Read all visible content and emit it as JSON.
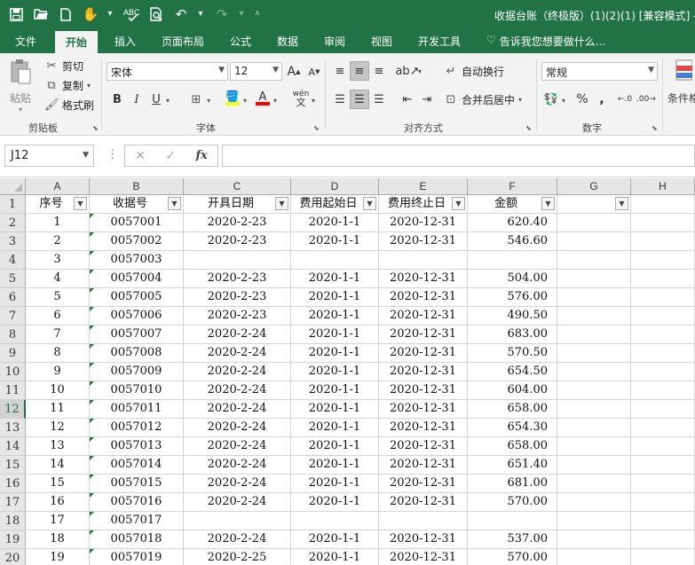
{
  "window": {
    "title": "收据台账（终极版）(1)(2)(1) [兼容模式] - E"
  },
  "quick_access": {
    "icons": [
      "save-icon",
      "open-icon",
      "new-icon",
      "touch-mode-icon",
      "spell-check-icon",
      "print-preview-icon",
      "undo-icon",
      "redo-icon",
      "customize-icon"
    ]
  },
  "tabs": [
    {
      "label": "文件",
      "active": false
    },
    {
      "label": "开始",
      "active": true
    },
    {
      "label": "插入",
      "active": false
    },
    {
      "label": "页面布局",
      "active": false
    },
    {
      "label": "公式",
      "active": false
    },
    {
      "label": "数据",
      "active": false
    },
    {
      "label": "审阅",
      "active": false
    },
    {
      "label": "视图",
      "active": false
    },
    {
      "label": "开发工具",
      "active": false
    }
  ],
  "tell_me": "告诉我您想要做什么...",
  "ribbon": {
    "clipboard": {
      "paste": "粘贴",
      "cut": "剪切",
      "copy": "复制",
      "format_painter": "格式刷",
      "label": "剪贴板"
    },
    "font": {
      "name": "宋体",
      "size": "12",
      "bold": "B",
      "italic": "I",
      "underline": "U",
      "grow": "A",
      "shrink": "A",
      "wen": "wén",
      "label": "字体"
    },
    "alignment": {
      "wrap_text": "自动换行",
      "merge_center": "合并后居中",
      "label": "对齐方式"
    },
    "number": {
      "format": "常规",
      "percent": "%",
      "comma": ",",
      "label": "数字"
    },
    "styles": {
      "conditional": "条件格"
    }
  },
  "formula_bar": {
    "name_box": "J12",
    "cancel": "✕",
    "enter": "✓",
    "fx": "fx",
    "value": ""
  },
  "sheet": {
    "columns": [
      "A",
      "B",
      "C",
      "D",
      "E",
      "F",
      "G",
      "H"
    ],
    "selected_row": "12",
    "headers": [
      "序号",
      "收据号",
      "开具日期",
      "费用起始日",
      "费用终止日",
      "金额",
      ""
    ],
    "rows": [
      {
        "num": "2",
        "cells": [
          "1",
          "0057001",
          "2020-2-23",
          "2020-1-1",
          "2020-12-31",
          "620.40"
        ]
      },
      {
        "num": "3",
        "cells": [
          "2",
          "0057002",
          "2020-2-23",
          "2020-1-1",
          "2020-12-31",
          "546.60"
        ]
      },
      {
        "num": "4",
        "cells": [
          "3",
          "0057003",
          "",
          "",
          "",
          ""
        ]
      },
      {
        "num": "5",
        "cells": [
          "4",
          "0057004",
          "2020-2-23",
          "2020-1-1",
          "2020-12-31",
          "504.00"
        ]
      },
      {
        "num": "6",
        "cells": [
          "5",
          "0057005",
          "2020-2-23",
          "2020-1-1",
          "2020-12-31",
          "576.00"
        ]
      },
      {
        "num": "7",
        "cells": [
          "6",
          "0057006",
          "2020-2-23",
          "2020-1-1",
          "2020-12-31",
          "490.50"
        ]
      },
      {
        "num": "8",
        "cells": [
          "7",
          "0057007",
          "2020-2-24",
          "2020-1-1",
          "2020-12-31",
          "683.00"
        ]
      },
      {
        "num": "9",
        "cells": [
          "8",
          "0057008",
          "2020-2-24",
          "2020-1-1",
          "2020-12-31",
          "570.50"
        ]
      },
      {
        "num": "10",
        "cells": [
          "9",
          "0057009",
          "2020-2-24",
          "2020-1-1",
          "2020-12-31",
          "654.50"
        ]
      },
      {
        "num": "11",
        "cells": [
          "10",
          "0057010",
          "2020-2-24",
          "2020-1-1",
          "2020-12-31",
          "604.00"
        ]
      },
      {
        "num": "12",
        "cells": [
          "11",
          "0057011",
          "2020-2-24",
          "2020-1-1",
          "2020-12-31",
          "658.00"
        ]
      },
      {
        "num": "13",
        "cells": [
          "12",
          "0057012",
          "2020-2-24",
          "2020-1-1",
          "2020-12-31",
          "654.30"
        ]
      },
      {
        "num": "14",
        "cells": [
          "13",
          "0057013",
          "2020-2-24",
          "2020-1-1",
          "2020-12-31",
          "658.00"
        ]
      },
      {
        "num": "15",
        "cells": [
          "14",
          "0057014",
          "2020-2-24",
          "2020-1-1",
          "2020-12-31",
          "651.40"
        ]
      },
      {
        "num": "16",
        "cells": [
          "15",
          "0057015",
          "2020-2-24",
          "2020-1-1",
          "2020-12-31",
          "681.00"
        ]
      },
      {
        "num": "17",
        "cells": [
          "16",
          "0057016",
          "2020-2-24",
          "2020-1-1",
          "2020-12-31",
          "570.00"
        ]
      },
      {
        "num": "18",
        "cells": [
          "17",
          "0057017",
          "",
          "",
          "",
          ""
        ]
      },
      {
        "num": "19",
        "cells": [
          "18",
          "0057018",
          "2020-2-24",
          "2020-1-1",
          "2020-12-31",
          "537.00"
        ]
      },
      {
        "num": "20",
        "cells": [
          "19",
          "0057019",
          "2020-2-25",
          "2020-1-1",
          "2020-12-31",
          "570.00"
        ]
      }
    ]
  }
}
